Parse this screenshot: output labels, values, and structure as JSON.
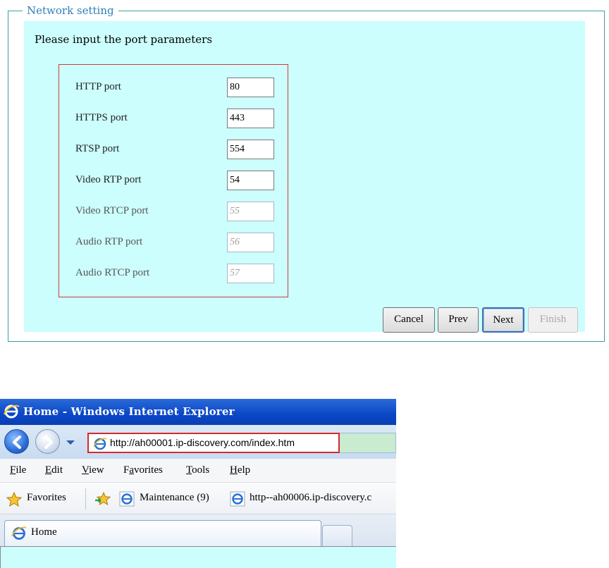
{
  "network_setting": {
    "legend": "Network setting",
    "instruction": "Please input the port parameters",
    "ports": [
      {
        "label": "HTTP port",
        "value": "80",
        "enabled": true
      },
      {
        "label": "HTTPS port",
        "value": "443",
        "enabled": true
      },
      {
        "label": "RTSP port",
        "value": "554",
        "enabled": true
      },
      {
        "label": "Video RTP port",
        "value": "54",
        "enabled": true
      },
      {
        "label": "Video RTCP port",
        "value": "55",
        "enabled": false
      },
      {
        "label": "Audio RTP port",
        "value": "56",
        "enabled": false
      },
      {
        "label": "Audio RTCP port",
        "value": "57",
        "enabled": false
      }
    ],
    "buttons": {
      "cancel": "Cancel",
      "prev": "Prev",
      "next": "Next",
      "finish": "Finish"
    }
  },
  "browser": {
    "window_title": "Home - Windows Internet Explorer",
    "address_url": "http://ah00001.ip-discovery.com/index.htm",
    "menu": [
      "File",
      "Edit",
      "View",
      "Favorites",
      "Tools",
      "Help"
    ],
    "menu_access_keys": [
      "F",
      "E",
      "V",
      "a",
      "T",
      "H"
    ],
    "favorites_label": "Favorites",
    "favorites_items": [
      "Maintenance (9)",
      "http--ah00006.ip-discovery.c"
    ],
    "tab_label": "Home",
    "icons": {
      "browser": "internet-explorer-icon",
      "back": "back-arrow-icon",
      "forward": "forward-arrow-icon",
      "favorites": "star-icon",
      "add_favorite": "add-to-favorites-icon"
    },
    "colors": {
      "titlebar": "#0b47c6",
      "address_highlight": "#d42a2a",
      "page_background": "#ccfefe"
    }
  }
}
